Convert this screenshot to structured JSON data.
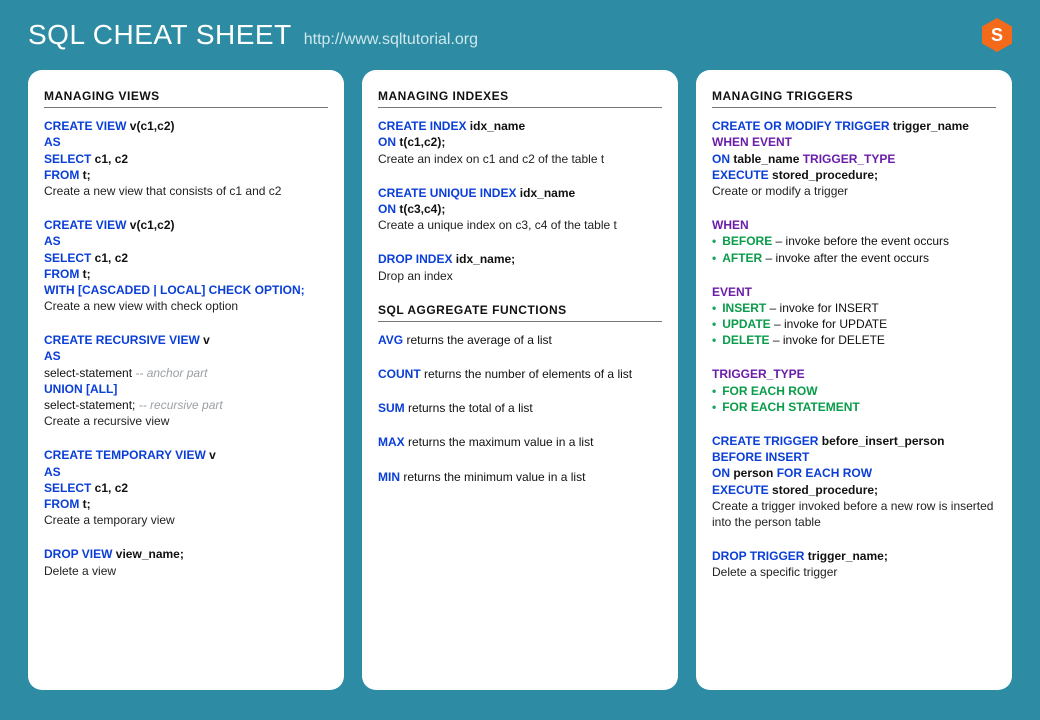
{
  "header": {
    "title": "SQL CHEAT SHEET",
    "url": "http://www.sqltutorial.org",
    "logo_letter": "S"
  },
  "col1": {
    "heading": "MANAGING  VIEWS",
    "b1": {
      "l1a": "CREATE VIEW",
      "l1b": " v(c1,c2)",
      "l2": "AS",
      "l3a": "SELECT",
      "l3b": " c1, c2",
      "l4a": "FROM",
      "l4b": " t;",
      "desc": "Create a new view that consists  of c1 and c2"
    },
    "b2": {
      "l1a": "CREATE VIEW",
      "l1b": " v(c1,c2)",
      "l2": "AS",
      "l3a": "SELECT",
      "l3b": " c1, c2",
      "l4a": "FROM",
      "l4b": " t;",
      "l5a": "WITH [CASCADED | LOCAL] CHECK OPTION;",
      "desc": "Create a new view with check option"
    },
    "b3": {
      "l1a": "CREATE RECURSIVE  VIEW",
      "l1b": " v",
      "l2": "AS",
      "l3": "select-statement ",
      "l3c": "-- anchor part",
      "l4": "UNION [ALL]",
      "l5": "select-statement; ",
      "l5c": "-- recursive part",
      "desc": "Create a recursive view"
    },
    "b4": {
      "l1a": "CREATE TEMPORARY  VIEW",
      "l1b": " v",
      "l2": "AS",
      "l3a": "SELECT",
      "l3b": " c1, c2",
      "l4a": "FROM",
      "l4b": " t;",
      "desc": "Create a temporary view"
    },
    "b5": {
      "l1a": "DROP VIEW",
      "l1b": " view_name;",
      "desc": "Delete a view"
    }
  },
  "col2": {
    "heading1": "MANAGING  INDEXES",
    "i1": {
      "l1a": "CREATE INDEX",
      "l1b": " idx_name",
      "l2a": "ON",
      "l2b": " t(c1,c2);",
      "desc": "Create an index on c1 and c2 of the table t"
    },
    "i2": {
      "l1a": "CREATE UNIQUE INDEX",
      "l1b": " idx_name",
      "l2a": "ON",
      "l2b": " t(c3,c4);",
      "desc": "Create a unique index on c3, c4 of the table t"
    },
    "i3": {
      "l1a": "DROP INDEX",
      "l1b": " idx_name;",
      "desc": "Drop an index"
    },
    "heading2": "SQL AGGREGATE  FUNCTIONS",
    "agg": [
      {
        "kw": "AVG",
        "txt": " returns the average of a list"
      },
      {
        "kw": "COUNT",
        "txt": " returns the number of elements of a list"
      },
      {
        "kw": "SUM",
        "txt": " returns the total of a list"
      },
      {
        "kw": "MAX",
        "txt": " returns the maximum value in a list"
      },
      {
        "kw": "MIN",
        "txt": " returns the minimum  value in a list"
      }
    ]
  },
  "col3": {
    "heading": "MANAGING  TRIGGERS",
    "t1": {
      "l1a": "CREATE OR MODIFY TRIGGER",
      "l1b": " trigger_name",
      "l2": "WHEN EVENT",
      "l3a": "ON",
      "l3b": " table_name ",
      "l3c": "TRIGGER_TYPE",
      "l4a": "EXECUTE",
      "l4b": " stored_procedure;",
      "desc": "Create or modify a trigger"
    },
    "when_h": "WHEN",
    "when": [
      {
        "kw": "BEFORE",
        "txt": " – invoke before the event occurs"
      },
      {
        "kw": "AFTER",
        "txt": " – invoke after the event occurs"
      }
    ],
    "event_h": "EVENT",
    "event": [
      {
        "kw": "INSERT",
        "txt": " – invoke for INSERT"
      },
      {
        "kw": "UPDATE",
        "txt": " – invoke for UPDATE"
      },
      {
        "kw": "DELETE",
        "txt": " – invoke for DELETE"
      }
    ],
    "tt_h": "TRIGGER_TYPE",
    "tt": [
      {
        "kw": "FOR EACH ROW"
      },
      {
        "kw": "FOR EACH STATEMENT"
      }
    ],
    "t2": {
      "l1a": "CREATE TRIGGER",
      "l1b": " before_insert_person",
      "l2": "BEFORE INSERT",
      "l3a": "ON",
      "l3b": " person ",
      "l3c": "FOR EACH ROW",
      "l4a": "EXECUTE",
      "l4b": " stored_procedure;",
      "desc": "Create a trigger invoked before a new row is inserted into the person table"
    },
    "t3": {
      "l1a": "DROP TRIGGER",
      "l1b": " trigger_name;",
      "desc": "Delete a specific trigger"
    }
  }
}
